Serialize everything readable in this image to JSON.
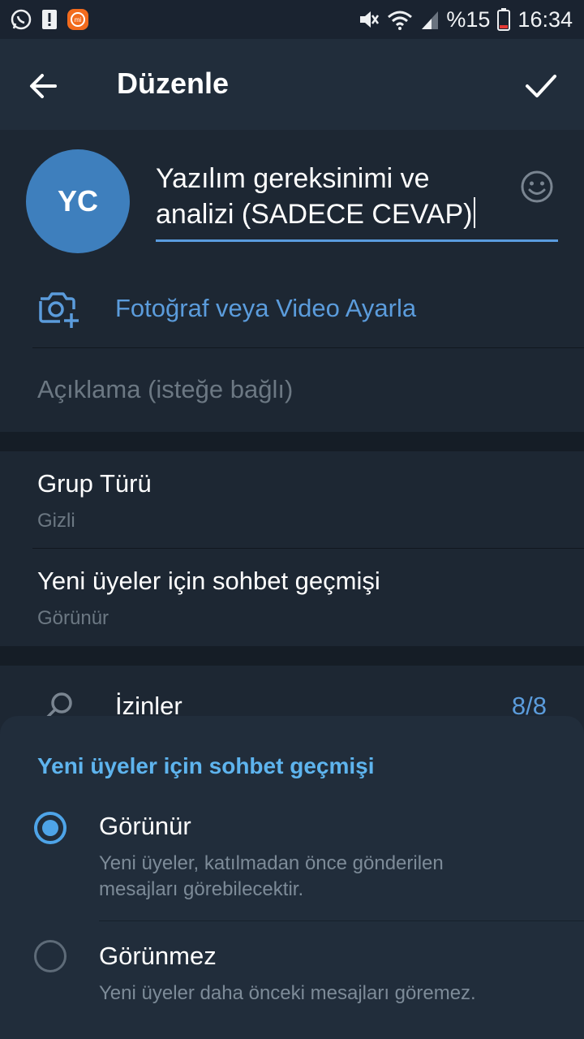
{
  "status_bar": {
    "battery_percent": "%15",
    "time": "16:34",
    "icons": [
      "whatsapp-icon",
      "alert-icon",
      "mi-icon",
      "mute-icon",
      "wifi-icon",
      "signal-icon",
      "battery-icon"
    ]
  },
  "app_bar": {
    "title": "Düzenle",
    "icons": [
      "back-arrow-icon",
      "checkmark-icon"
    ]
  },
  "group": {
    "avatar_initials": "YC",
    "avatar_color": "#3e7fbd",
    "name_line1": "Yazılım gereksinimi ve",
    "name_line2": "analizi (SADECE CEVAP)",
    "set_photo_label": "Fotoğraf veya Video Ayarla",
    "description_placeholder": "Açıklama (isteğe bağlı)"
  },
  "settings": {
    "group_type_title": "Grup Türü",
    "group_type_value": "Gizli",
    "history_title": "Yeni üyeler için sohbet geçmişi",
    "history_value": "Görünür",
    "permissions_label": "İzinler",
    "permissions_count": "8/8"
  },
  "sheet": {
    "title": "Yeni üyeler için sohbet geçmişi",
    "options": [
      {
        "title": "Görünür",
        "description": "Yeni üyeler, katılmadan önce gönderilen mesajları görebilecektir.",
        "selected": true
      },
      {
        "title": "Görünmez",
        "description": "Yeni üyeler daha önceki mesajları göremez.",
        "selected": false
      }
    ]
  },
  "colors": {
    "accent": "#5b9cdc",
    "sheet_title": "#5eb4ee",
    "background": "#1d2733",
    "radio_selected": "#4ea4e8"
  }
}
